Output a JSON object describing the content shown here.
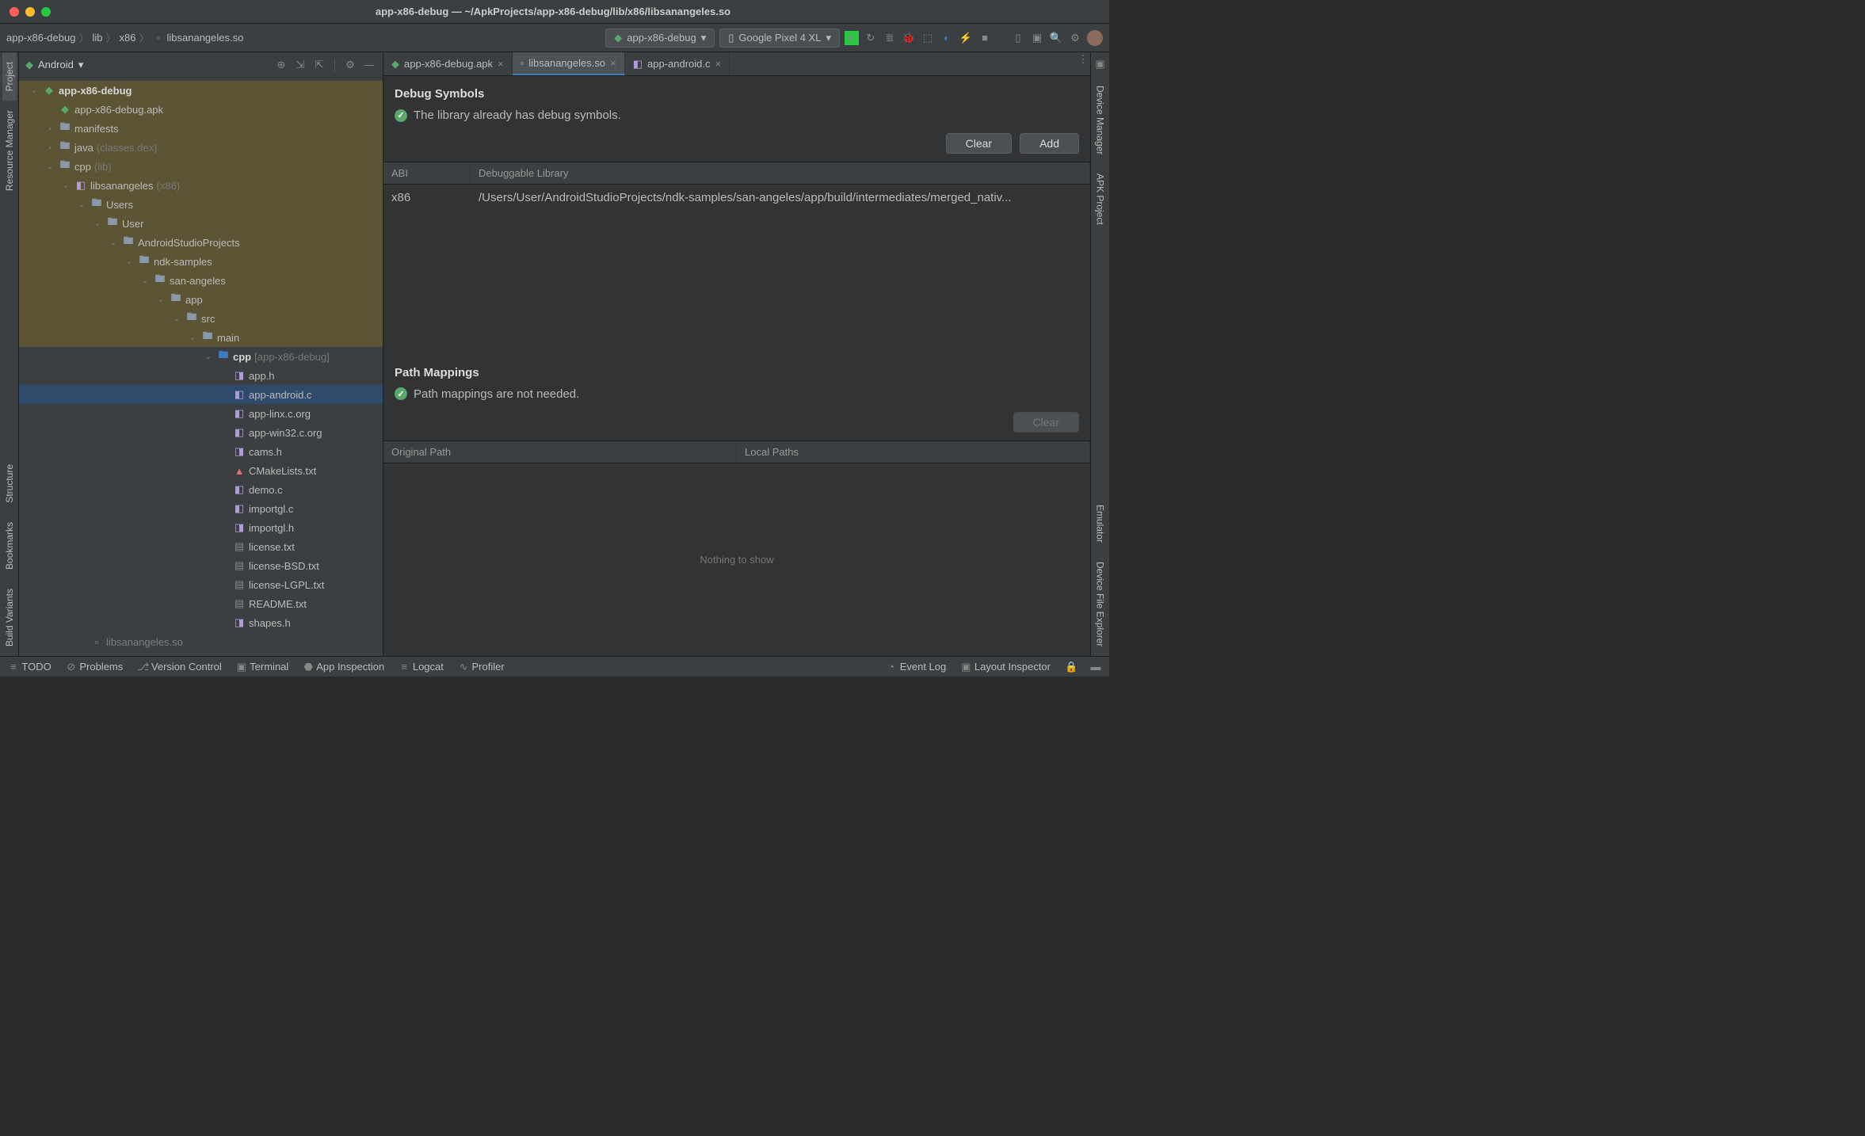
{
  "window": {
    "title": "app-x86-debug — ~/ApkProjects/app-x86-debug/lib/x86/libsanangeles.so"
  },
  "breadcrumb": [
    "app-x86-debug",
    "lib",
    "x86",
    "libsanangeles.so"
  ],
  "toolbar": {
    "run_config": "app-x86-debug",
    "device": "Google Pixel 4 XL"
  },
  "left_tabs": [
    "Project",
    "Resource Manager",
    "Structure",
    "Bookmarks",
    "Build Variants"
  ],
  "right_tabs": [
    "Device Manager",
    "APK Project",
    "Emulator",
    "Device File Explorer"
  ],
  "panel": {
    "title": "Android"
  },
  "tree": [
    {
      "d": 0,
      "a": "v",
      "k": "module",
      "t": "app-x86-debug",
      "bold": true,
      "hl": true
    },
    {
      "d": 1,
      "a": "",
      "k": "apk",
      "t": "app-x86-debug.apk",
      "hl": true
    },
    {
      "d": 1,
      "a": ">",
      "k": "folder",
      "t": "manifests",
      "hl": true
    },
    {
      "d": 1,
      "a": ">",
      "k": "folder",
      "t": "java",
      "hint": "(classes.dex)",
      "hl": true
    },
    {
      "d": 1,
      "a": "v",
      "k": "folder",
      "t": "cpp",
      "hint": "(lib)",
      "hl": true
    },
    {
      "d": 2,
      "a": "v",
      "k": "lib",
      "t": "libsanangeles",
      "hint": "(x86)",
      "hl": true
    },
    {
      "d": 3,
      "a": "v",
      "k": "folder",
      "t": "Users",
      "hl": true
    },
    {
      "d": 4,
      "a": "v",
      "k": "folder",
      "t": "User",
      "hl": true
    },
    {
      "d": 5,
      "a": "v",
      "k": "folder",
      "t": "AndroidStudioProjects",
      "hl": true
    },
    {
      "d": 6,
      "a": "v",
      "k": "folder",
      "t": "ndk-samples",
      "hl": true
    },
    {
      "d": 7,
      "a": "v",
      "k": "folder",
      "t": "san-angeles",
      "hl": true
    },
    {
      "d": 8,
      "a": "v",
      "k": "folder",
      "t": "app",
      "hl": true
    },
    {
      "d": 9,
      "a": "v",
      "k": "folder",
      "t": "src",
      "hl": true
    },
    {
      "d": 10,
      "a": "v",
      "k": "folder",
      "t": "main",
      "hl": true
    },
    {
      "d": 11,
      "a": "v",
      "k": "srcfolder",
      "t": "cpp",
      "hint": "[app-x86-debug]",
      "bold": true
    },
    {
      "d": 12,
      "a": "",
      "k": "h",
      "t": "app.h"
    },
    {
      "d": 12,
      "a": "",
      "k": "c",
      "t": "app-android.c",
      "sel": true
    },
    {
      "d": 12,
      "a": "",
      "k": "c",
      "t": "app-linx.c.org"
    },
    {
      "d": 12,
      "a": "",
      "k": "c",
      "t": "app-win32.c.org"
    },
    {
      "d": 12,
      "a": "",
      "k": "h",
      "t": "cams.h"
    },
    {
      "d": 12,
      "a": "",
      "k": "cmake",
      "t": "CMakeLists.txt"
    },
    {
      "d": 12,
      "a": "",
      "k": "c",
      "t": "demo.c"
    },
    {
      "d": 12,
      "a": "",
      "k": "c",
      "t": "importgl.c"
    },
    {
      "d": 12,
      "a": "",
      "k": "h",
      "t": "importgl.h"
    },
    {
      "d": 12,
      "a": "",
      "k": "txt",
      "t": "license.txt"
    },
    {
      "d": 12,
      "a": "",
      "k": "txt",
      "t": "license-BSD.txt"
    },
    {
      "d": 12,
      "a": "",
      "k": "txt",
      "t": "license-LGPL.txt"
    },
    {
      "d": 12,
      "a": "",
      "k": "txt",
      "t": "README.txt"
    },
    {
      "d": 12,
      "a": "",
      "k": "h",
      "t": "shapes.h"
    },
    {
      "d": 3,
      "a": "",
      "k": "so",
      "t": "libsanangeles.so",
      "dim": true
    }
  ],
  "editor_tabs": [
    {
      "label": "app-x86-debug.apk",
      "active": false
    },
    {
      "label": "libsanangeles.so",
      "active": true
    },
    {
      "label": "app-android.c",
      "active": false
    }
  ],
  "debug": {
    "title": "Debug Symbols",
    "status": "The library already has debug symbols.",
    "clear": "Clear",
    "add": "Add",
    "col_abi": "ABI",
    "col_lib": "Debuggable Library",
    "row_abi": "x86",
    "row_path": "/Users/User/AndroidStudioProjects/ndk-samples/san-angeles/app/build/intermediates/merged_nativ..."
  },
  "mappings": {
    "title": "Path Mappings",
    "status": "Path mappings are not needed.",
    "clear": "Clear",
    "col_orig": "Original Path",
    "col_local": "Local Paths",
    "empty": "Nothing to show"
  },
  "statusbar": {
    "items_left": [
      "TODO",
      "Problems",
      "Version Control",
      "Terminal",
      "App Inspection",
      "Logcat",
      "Profiler"
    ],
    "items_right": [
      "Event Log",
      "Layout Inspector"
    ]
  }
}
